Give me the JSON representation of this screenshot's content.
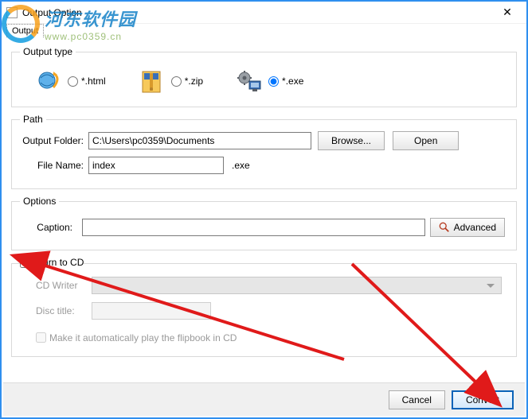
{
  "window": {
    "title": "Output Option"
  },
  "tab": {
    "label": "Output"
  },
  "output_type": {
    "legend": "Output type",
    "html_label": "*.html",
    "zip_label": "*.zip",
    "exe_label": "*.exe",
    "selected": "exe"
  },
  "path": {
    "legend": "Path",
    "folder_label": "Output Folder:",
    "folder_value": "C:\\Users\\pc0359\\Documents",
    "browse_label": "Browse...",
    "open_label": "Open",
    "filename_label": "File Name:",
    "filename_value": "index",
    "ext_label": ".exe"
  },
  "options": {
    "legend": "Options",
    "caption_label": "Caption:",
    "caption_value": "",
    "advanced_label": "Advanced"
  },
  "burn": {
    "legend": "Burn to CD",
    "checked": false,
    "cdwriter_label": "CD Writer",
    "disc_title_label": "Disc title:",
    "disc_title_value": "",
    "autoplay_label": "Make it automatically play the flipbook in CD"
  },
  "footer": {
    "cancel_label": "Cancel",
    "convert_label": "Convert"
  },
  "watermark": {
    "cn": "河东软件园",
    "url": "www.pc0359.cn"
  }
}
